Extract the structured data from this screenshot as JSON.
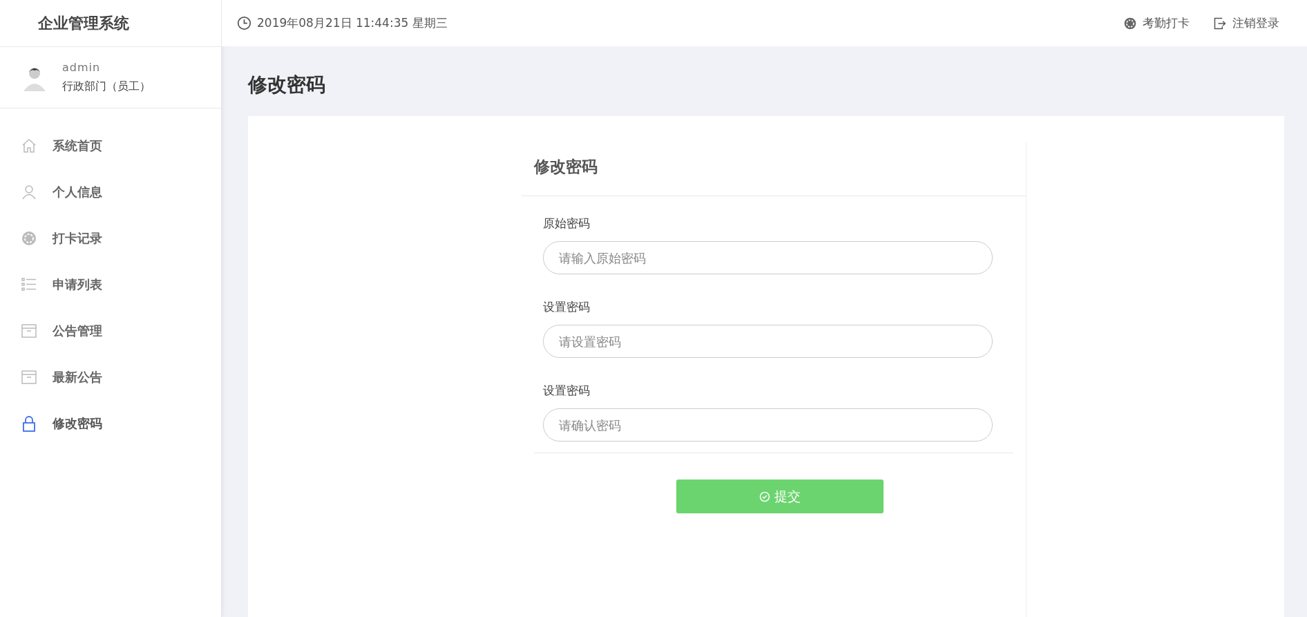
{
  "app_title": "企业管理系统",
  "header": {
    "datetime": "2019年08月21日 11:44:35 星期三",
    "actions": [
      {
        "label": "考勤打卡"
      },
      {
        "label": "注销登录"
      }
    ]
  },
  "user": {
    "name": "admin",
    "department": "行政部门（员工）"
  },
  "sidebar": {
    "items": [
      {
        "label": "系统首页",
        "selected": false
      },
      {
        "label": "个人信息",
        "selected": false
      },
      {
        "label": "打卡记录",
        "selected": false
      },
      {
        "label": "申请列表",
        "selected": false
      },
      {
        "label": "公告管理",
        "selected": false
      },
      {
        "label": "最新公告",
        "selected": false
      },
      {
        "label": "修改密码",
        "selected": true
      }
    ]
  },
  "page_title": "修改密码",
  "form": {
    "title": "修改密码",
    "fields": [
      {
        "label": "原始密码",
        "placeholder": "请输入原始密码"
      },
      {
        "label": "设置密码",
        "placeholder": "请设置密码"
      },
      {
        "label": "设置密码",
        "placeholder": "请确认密码"
      }
    ],
    "submit": "提交"
  }
}
